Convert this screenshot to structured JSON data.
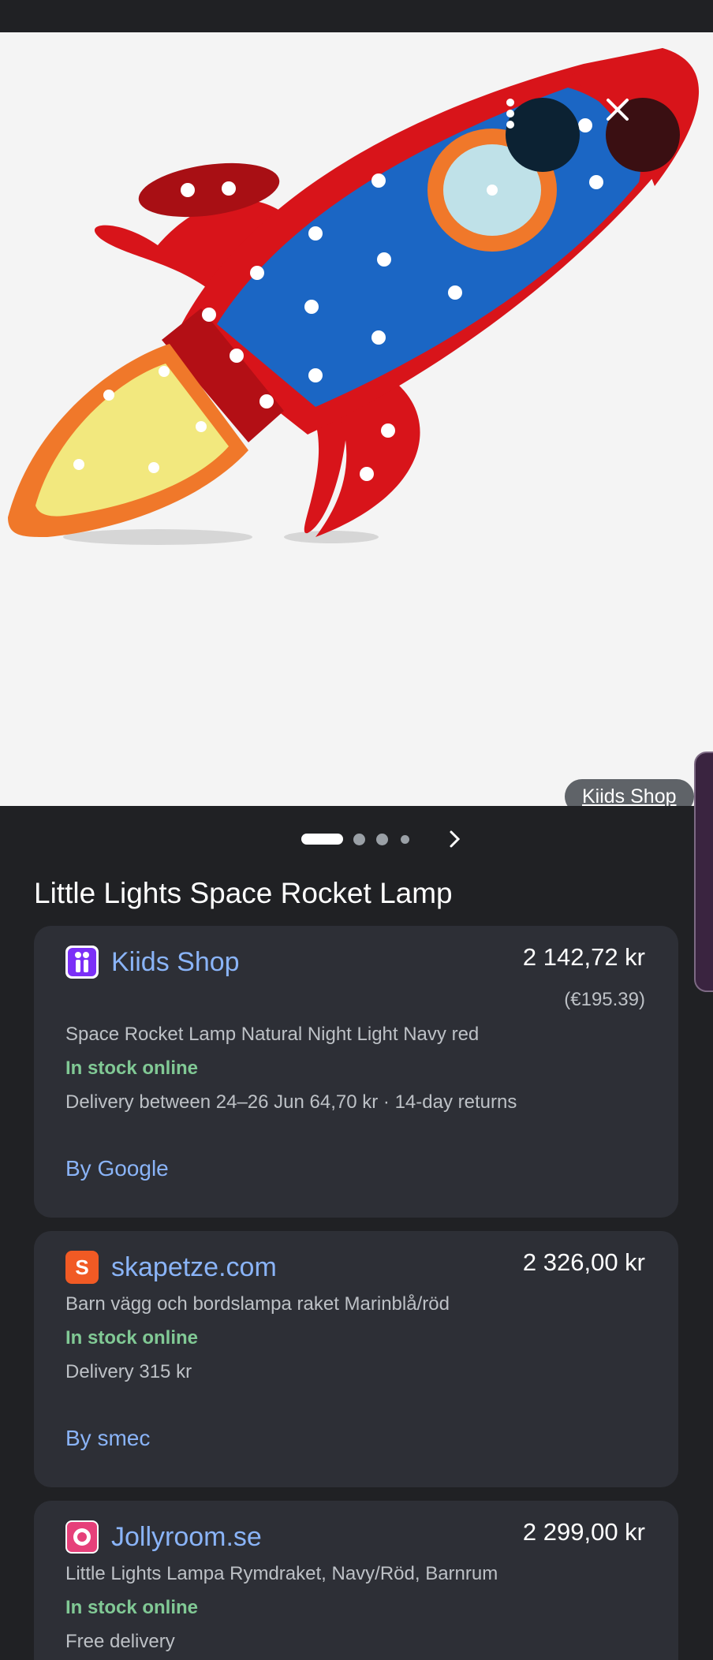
{
  "hero": {
    "source_chip": "Kiids Shop"
  },
  "icons": {
    "more": "more-vert-icon",
    "close": "close-icon",
    "next": "chevron-right-icon"
  },
  "colors": {
    "background": "#202124",
    "card": "#2d2f36",
    "link": "#8ab4f8",
    "in_stock": "#81c995"
  },
  "product": {
    "title": "Little Lights Space Rocket Lamp"
  },
  "offers": [
    {
      "merchant": "Kiids Shop",
      "price": "2 142,72 kr",
      "price_original": "(€195.39)",
      "description": "Space Rocket Lamp Natural Night Light Navy red",
      "stock": "In stock online",
      "delivery": "Delivery between 24–26 Jun 64,70 kr · 14-day returns",
      "seller": "By Google"
    },
    {
      "merchant": "skapetze.com",
      "logo_letter": "S",
      "price": "2 326,00 kr",
      "description": "Barn vägg och bordslampa raket Marinblå/röd",
      "stock": "In stock online",
      "delivery": "Delivery 315 kr",
      "seller": "By smec"
    },
    {
      "merchant": "Jollyroom.se",
      "price": "2 299,00 kr",
      "description": "Little Lights Lampa Rymdraket, Navy/Röd, Barnrum",
      "stock": "In stock online",
      "delivery": "Free delivery"
    }
  ]
}
